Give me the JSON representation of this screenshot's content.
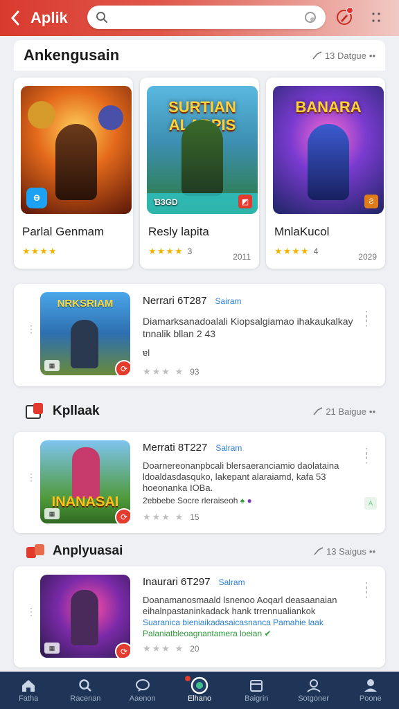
{
  "header": {
    "title": "Aplik",
    "search_placeholder": "",
    "notification_badge": true
  },
  "section1": {
    "title": "Ankengusain",
    "meta": "13 Datgue",
    "tiles": [
      {
        "name": "Parlal Genmam",
        "art_title": "",
        "rating_count": "",
        "year": "",
        "stars": "★★★★",
        "colors": [
          "#f08a24",
          "#7a1e0e"
        ],
        "corner": "Ɵ"
      },
      {
        "name": "Resly lapita",
        "art_title": "SURTIAN ALARPIS",
        "rating_count": "3",
        "year": "2011",
        "stars": "★★★★",
        "colors": [
          "#3fa7c9",
          "#2d7a3a"
        ],
        "corner_label": "Ɓ3GD"
      },
      {
        "name": "MnlaKucol",
        "art_title": "BANARA",
        "rating_count": "4",
        "year": "2029",
        "stars": "★★★★",
        "colors": [
          "#6a3bb8",
          "#1f2a6e"
        ],
        "corner": ""
      }
    ]
  },
  "list1": {
    "title": "Nerrari 6T287",
    "tag": "Sairam",
    "desc": "Diamarksanadoalali Kiopsalgiamao ihakaukalkay tnnalik bllan 2 43",
    "desc_extra": "ɐl",
    "rating_count": "93",
    "thumb_title": "NRKSRIAM"
  },
  "section2": {
    "title": "Kpllaak",
    "meta": "21 Baigue"
  },
  "list2": {
    "title": "Merrati 8T227",
    "tag": "Salram",
    "desc": "Doarnereonanpbcali blersaeranciamio daolataina ldoaldasdasquko, lakepant alaraiamd, kafa 53 hoeonanka IOBa.",
    "extra_line": "2ɐbbebe Socre rleraiseoh",
    "rating_count": "15",
    "thumb_title": "INANASAI"
  },
  "section3": {
    "title": "Anplyuasai",
    "meta": "13 Saigus"
  },
  "list3": {
    "title": "Inaurari 6T297",
    "tag": "Salram",
    "desc": "Doanamanosmaald lsnenoo Aoqarl deasaanaian eihalnpastaninkadack hank trrennualiankok",
    "green_line1": "Suaranica bieniaikadasaicasnanca Pamahie laak",
    "green_line2": "Palaniatbleoagnantamera loeian",
    "rating_count": "20"
  },
  "bottom_nav": [
    {
      "label": "Fatha",
      "icon": "home-icon"
    },
    {
      "label": "Racenan",
      "icon": "search-icon"
    },
    {
      "label": "Aaenon",
      "icon": "chat-icon"
    },
    {
      "label": "Elhano",
      "icon": "games-icon",
      "active": true
    },
    {
      "label": "Baigrin",
      "icon": "calendar-icon"
    },
    {
      "label": "Sotgoner",
      "icon": "profile-icon"
    },
    {
      "label": "Poone",
      "icon": "account-icon"
    }
  ]
}
